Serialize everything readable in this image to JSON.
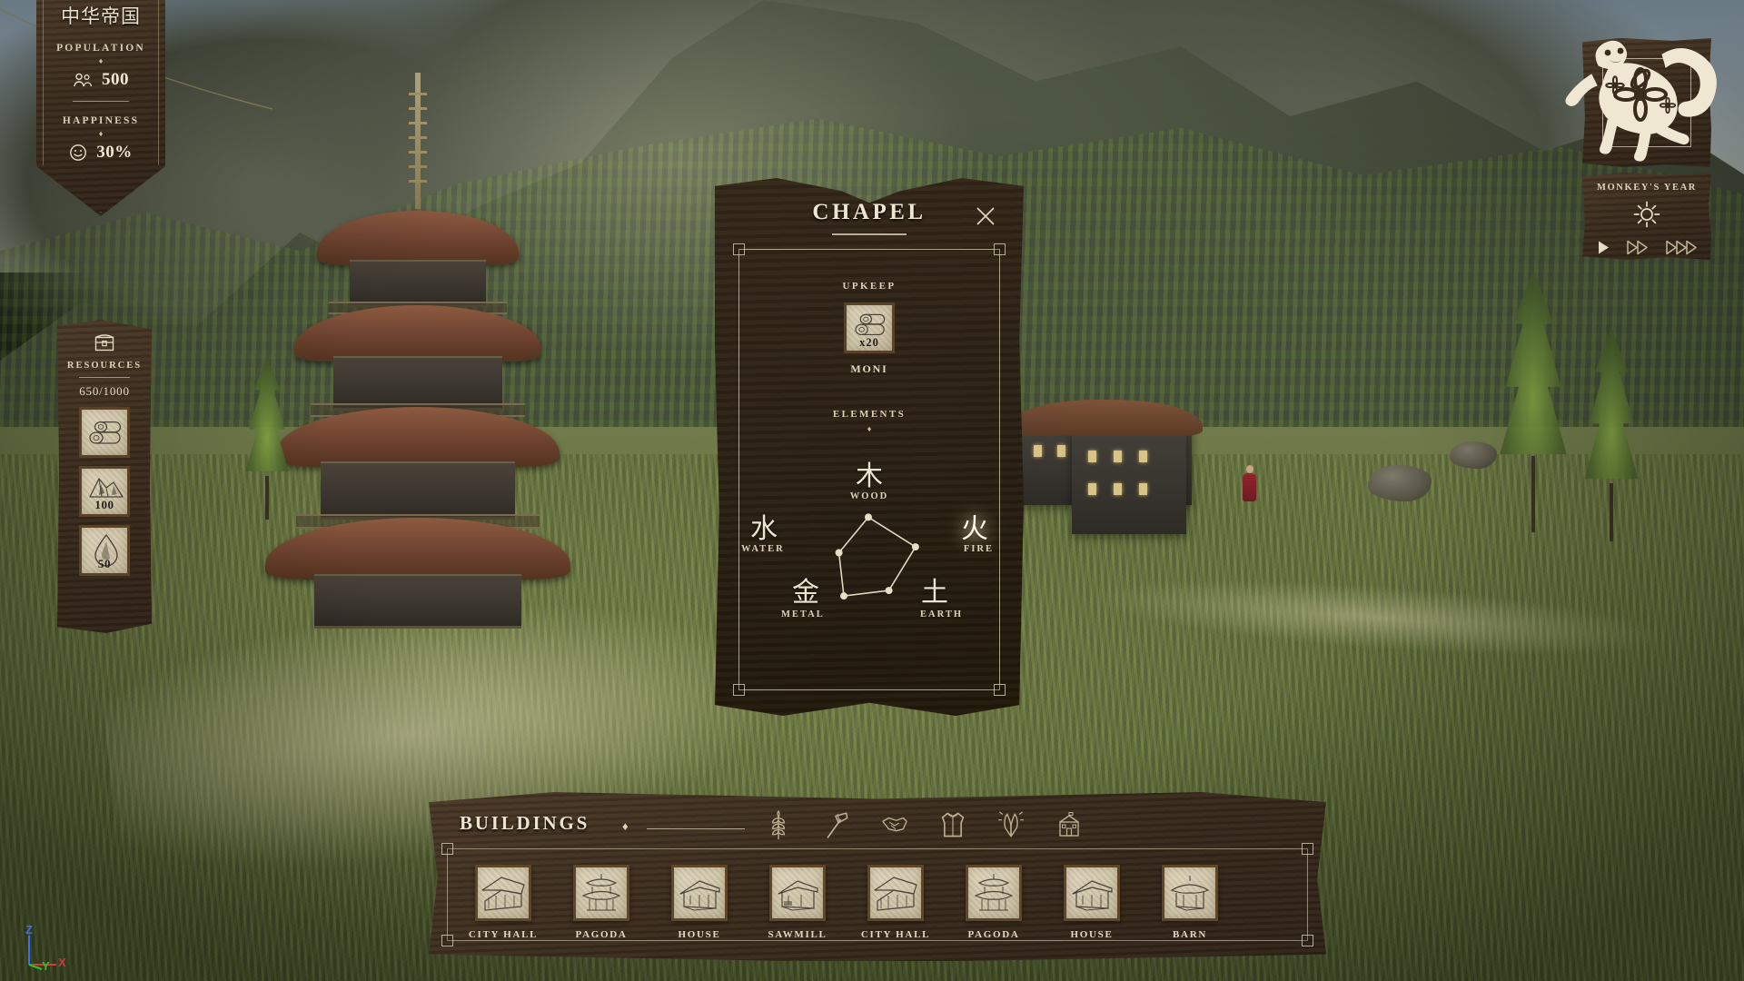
{
  "empire": {
    "name": "中华帝国",
    "population_label": "POPULATION",
    "population_value": "500",
    "happiness_label": "HAPPINESS",
    "happiness_value": "30%",
    "diamond": "♦",
    "population_icon": "people-icon",
    "happiness_icon": "smiley-icon"
  },
  "resources": {
    "title": "RESOURCES",
    "chest_icon": "chest-icon",
    "capacity": "650/1000",
    "items": [
      {
        "icon": "wood-logs-icon",
        "name": "WOOD",
        "amount": ""
      },
      {
        "icon": "stone-icon",
        "name": "STONE",
        "amount": "100"
      },
      {
        "icon": "water-drop-icon",
        "name": "WATER",
        "amount": "50"
      }
    ]
  },
  "chapel": {
    "title": "CHAPEL",
    "close_icon": "close-icon",
    "upkeep_label": "UPKEEP",
    "upkeep_icon": "wood-logs-icon",
    "upkeep_qty": "x20",
    "upkeep_name": "MONI",
    "elements_label": "ELEMENTS",
    "diamond": "♦",
    "elements": [
      {
        "han": "木",
        "name": "WOOD",
        "active": false
      },
      {
        "han": "水",
        "name": "WATER",
        "active": false
      },
      {
        "han": "火",
        "name": "FIRE",
        "active": true
      },
      {
        "han": "金",
        "name": "METAL",
        "active": false
      },
      {
        "han": "土",
        "name": "EARTH",
        "active": false
      }
    ]
  },
  "chart_data": {
    "type": "radar",
    "title": "ELEMENTS",
    "categories": [
      "WOOD",
      "FIRE",
      "EARTH",
      "METAL",
      "WATER"
    ],
    "categories_han": [
      "木",
      "火",
      "土",
      "金",
      "水"
    ],
    "values": [
      0.8,
      0.88,
      0.62,
      0.74,
      0.55
    ],
    "rmax": 1.0,
    "grid": false,
    "highlight": "FIRE"
  },
  "buildings": {
    "title": "BUILDINGS",
    "diamond": "♦",
    "categories": [
      {
        "icon": "wheat-icon",
        "name": "food"
      },
      {
        "icon": "hammer-icon",
        "name": "production"
      },
      {
        "icon": "handshake-icon",
        "name": "trade"
      },
      {
        "icon": "clothing-icon",
        "name": "goods"
      },
      {
        "icon": "praying-hands-icon",
        "name": "religion"
      },
      {
        "icon": "townhall-icon",
        "name": "civic"
      }
    ],
    "cards": [
      {
        "label": "CITY HALL",
        "icon": "city-hall-icon"
      },
      {
        "label": "PAGODA",
        "icon": "pagoda-icon"
      },
      {
        "label": "HOUSE",
        "icon": "house-icon"
      },
      {
        "label": "SAWMILL",
        "icon": "sawmill-icon"
      },
      {
        "label": "CITY HALL",
        "icon": "city-hall-icon"
      },
      {
        "label": "PAGODA",
        "icon": "pagoda-icon"
      },
      {
        "label": "HOUSE",
        "icon": "house-icon"
      },
      {
        "label": "BARN",
        "icon": "barn-icon"
      }
    ]
  },
  "zodiac": {
    "animal_icon": "monkey-icon",
    "year_label": "MONKEY'S YEAR",
    "weather_icon": "sun-icon",
    "speeds": [
      {
        "icon": "play-icon",
        "label": "normal"
      },
      {
        "icon": "ffwd-icon",
        "label": "fast"
      },
      {
        "icon": "fffwd-icon",
        "label": "fastest"
      }
    ]
  },
  "gizmo": {
    "x_label": "X",
    "y_label": "Y",
    "z_label": "Z",
    "x_color": "#d83838",
    "y_color": "#2fc22f",
    "z_color": "#3a6ef0"
  }
}
